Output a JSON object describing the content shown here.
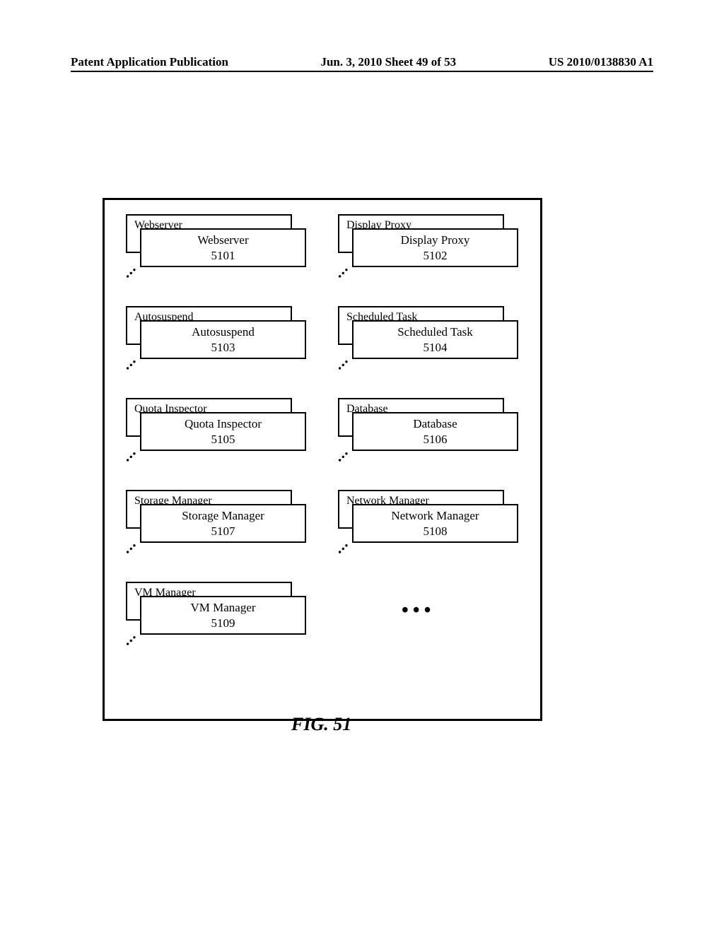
{
  "header": {
    "left": "Patent Application Publication",
    "middle": "Jun. 3, 2010  Sheet 49 of 53",
    "right": "US 2010/0138830 A1"
  },
  "figure_label": "FIG. 51",
  "groups": {
    "webserver": {
      "back": "Webserver",
      "front_name": "Webserver",
      "front_num": "5101"
    },
    "display_proxy": {
      "back": "Display Proxy",
      "front_name": "Display Proxy",
      "front_num": "5102"
    },
    "autosuspend": {
      "back": "Autosuspend",
      "front_name": "Autosuspend",
      "front_num": "5103"
    },
    "scheduled_task": {
      "back": "Scheduled Task",
      "front_name": "Scheduled Task",
      "front_num": "5104"
    },
    "quota_inspector": {
      "back": "Quota Inspector",
      "front_name": "Quota Inspector",
      "front_num": "5105"
    },
    "database": {
      "back": "Database",
      "front_name": "Database",
      "front_num": "5106"
    },
    "storage_manager": {
      "back": "Storage Manager",
      "front_name": "Storage Manager",
      "front_num": "5107"
    },
    "network_manager": {
      "back": "Network Manager",
      "front_name": "Network Manager",
      "front_num": "5108"
    },
    "vm_manager": {
      "back": "VM Manager",
      "front_name": "VM Manager",
      "front_num": "5109"
    }
  }
}
